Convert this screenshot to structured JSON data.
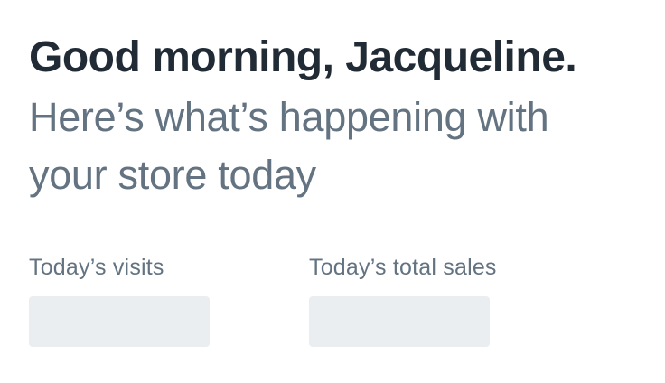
{
  "header": {
    "greeting": "Good morning, Jacqueline.",
    "subheading": "Here’s what’s happening with your store today"
  },
  "stats": [
    {
      "label": "Today’s visits",
      "value": ""
    },
    {
      "label": "Today’s total sales",
      "value": ""
    }
  ],
  "colors": {
    "heading": "#212b36",
    "subdued": "#637381",
    "skeleton": "#ebeef0"
  }
}
